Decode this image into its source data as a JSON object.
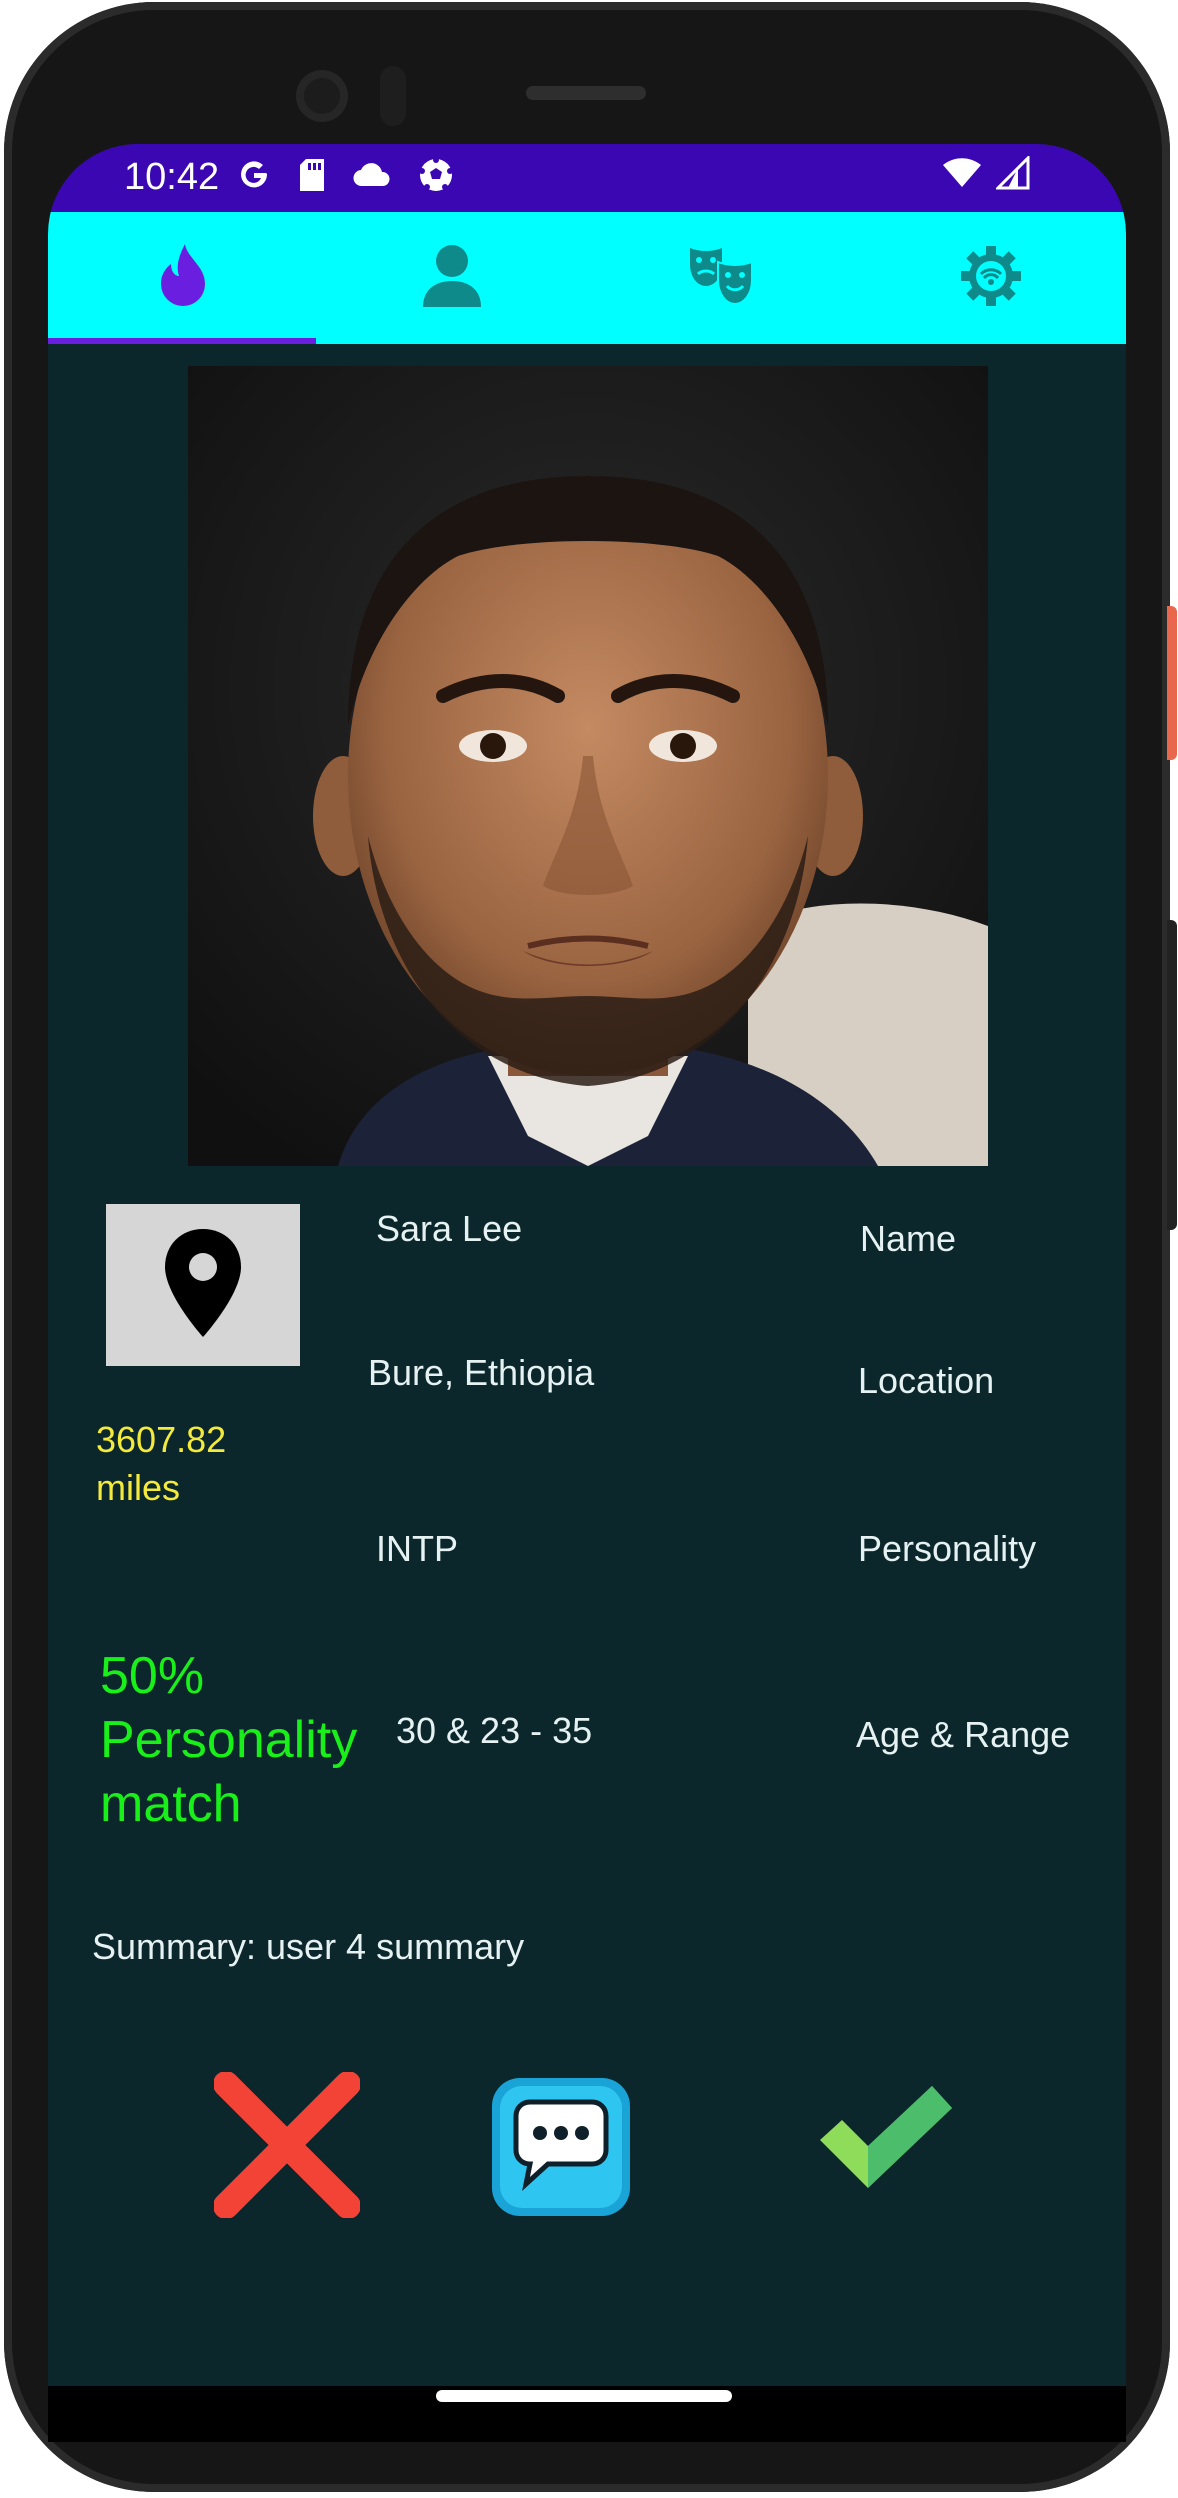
{
  "status_bar": {
    "time": "10:42",
    "left_icons": [
      "google-icon",
      "sd-card-icon",
      "cloud-icon",
      "soccer-ball-icon"
    ],
    "right_icons": [
      "wifi-icon",
      "cell-signal-icon"
    ]
  },
  "tabs": [
    {
      "icon": "flame-icon",
      "selected": true
    },
    {
      "icon": "person-icon",
      "selected": false
    },
    {
      "icon": "theater-masks-icon",
      "selected": false
    },
    {
      "icon": "settings-gear-icon",
      "selected": false
    }
  ],
  "profile": {
    "name": "Sara Lee",
    "location": "Bure, Ethiopia",
    "distance": "3607.82 miles",
    "personality": "INTP",
    "match": "50% Personality match",
    "age_range": "30 & 23 - 35",
    "summary": "Summary: user 4 summary"
  },
  "field_labels": {
    "name": "Name",
    "location": "Location",
    "personality": "Personality",
    "age_range": "Age & Range"
  },
  "actions": [
    "reject-x-icon",
    "chat-bubble-icon",
    "accept-check-icon"
  ],
  "colors": {
    "status_bar": "#3b07b3",
    "tab_bar": "#00ffff",
    "screen_bg": "#0b272c",
    "distance_text": "#f4ea3c",
    "match_text": "#19f019",
    "reject": "#f24336",
    "accept": "#5ed25e"
  }
}
